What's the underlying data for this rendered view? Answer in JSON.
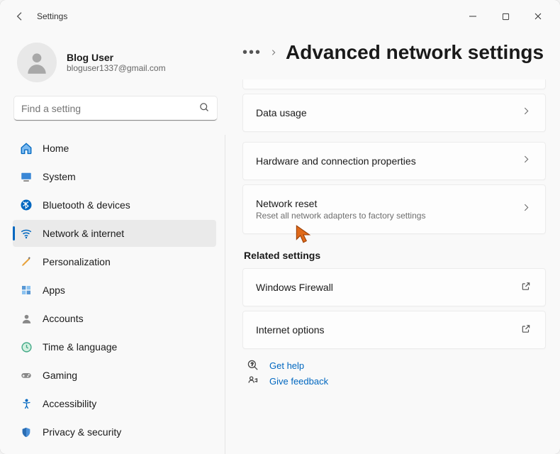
{
  "app": {
    "title": "Settings"
  },
  "profile": {
    "name": "Blog User",
    "email": "bloguser1337@gmail.com"
  },
  "search": {
    "placeholder": "Find a setting"
  },
  "nav": [
    {
      "label": "Home",
      "icon": "home"
    },
    {
      "label": "System",
      "icon": "system"
    },
    {
      "label": "Bluetooth & devices",
      "icon": "bluetooth"
    },
    {
      "label": "Network & internet",
      "icon": "wifi",
      "selected": true
    },
    {
      "label": "Personalization",
      "icon": "brush"
    },
    {
      "label": "Apps",
      "icon": "apps"
    },
    {
      "label": "Accounts",
      "icon": "person"
    },
    {
      "label": "Time & language",
      "icon": "clock"
    },
    {
      "label": "Gaming",
      "icon": "game"
    },
    {
      "label": "Accessibility",
      "icon": "accessibility"
    },
    {
      "label": "Privacy & security",
      "icon": "shield"
    }
  ],
  "crumbs": {
    "page_title": "Advanced network settings"
  },
  "cards": {
    "data_usage": {
      "title": "Data usage"
    },
    "hardware": {
      "title": "Hardware and connection properties"
    },
    "network_reset": {
      "title": "Network reset",
      "sub": "Reset all network adapters to factory settings"
    }
  },
  "related": {
    "heading": "Related settings",
    "firewall": {
      "title": "Windows Firewall"
    },
    "inet": {
      "title": "Internet options"
    }
  },
  "footer": {
    "help": "Get help",
    "feedback": "Give feedback"
  }
}
